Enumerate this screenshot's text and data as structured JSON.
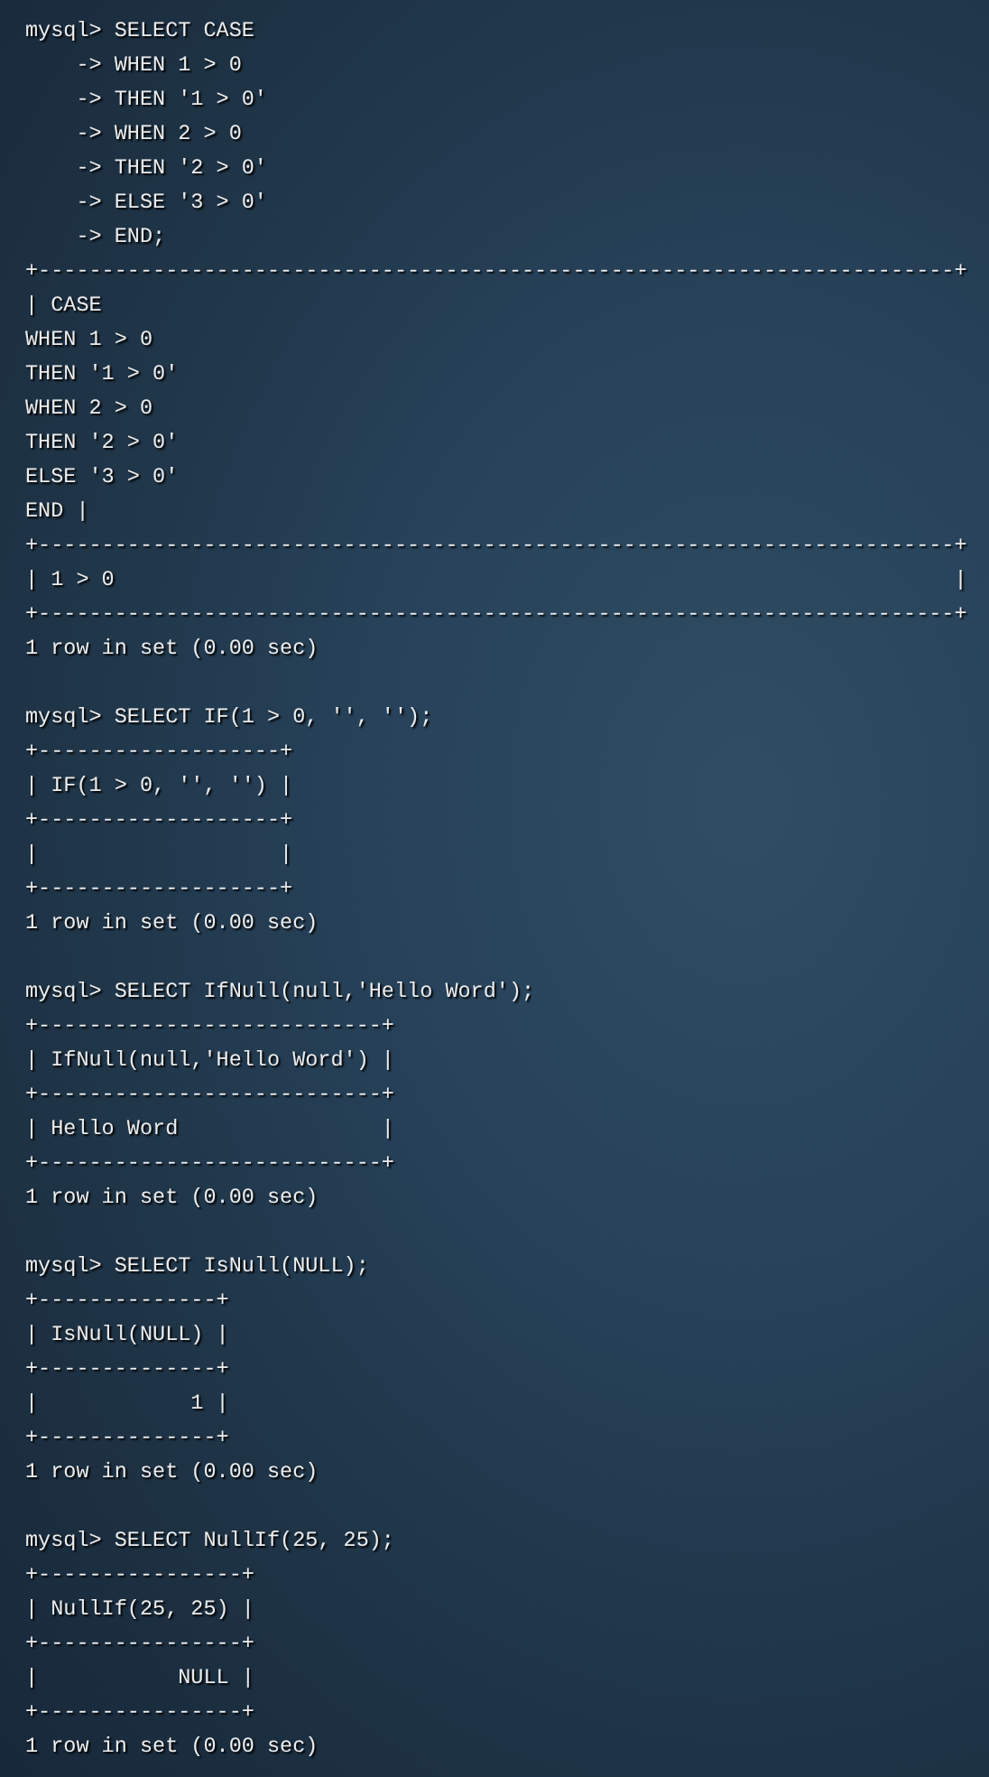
{
  "terminal": {
    "blocks": [
      {
        "command": [
          "mysql> SELECT CASE",
          "    -> WHEN 1 > 0",
          "    -> THEN '1 > 0'",
          "    -> WHEN 2 > 0",
          "    -> THEN '2 > 0'",
          "    -> ELSE '3 > 0'",
          "    -> END;"
        ],
        "table": [
          "+------------------------------------------------------------------------+",
          "| CASE",
          "WHEN 1 > 0",
          "THEN '1 > 0'",
          "WHEN 2 > 0",
          "THEN '2 > 0'",
          "ELSE '3 > 0'",
          "END |",
          "+------------------------------------------------------------------------+",
          "| 1 > 0                                                                  |",
          "+------------------------------------------------------------------------+"
        ],
        "summary": "1 row in set (0.00 sec)"
      },
      {
        "command": [
          "mysql> SELECT IF(1 > 0, '', '');"
        ],
        "table": [
          "+-------------------+",
          "| IF(1 > 0, '', '') |",
          "+-------------------+",
          "|                   |",
          "+-------------------+"
        ],
        "summary": "1 row in set (0.00 sec)"
      },
      {
        "command": [
          "mysql> SELECT IfNull(null,'Hello Word');"
        ],
        "table": [
          "+---------------------------+",
          "| IfNull(null,'Hello Word') |",
          "+---------------------------+",
          "| Hello Word                |",
          "+---------------------------+"
        ],
        "summary": "1 row in set (0.00 sec)"
      },
      {
        "command": [
          "mysql> SELECT IsNull(NULL);"
        ],
        "table": [
          "+--------------+",
          "| IsNull(NULL) |",
          "+--------------+",
          "|            1 |",
          "+--------------+"
        ],
        "summary": "1 row in set (0.00 sec)"
      },
      {
        "command": [
          "mysql> SELECT NullIf(25, 25);"
        ],
        "table": [
          "+----------------+",
          "| NullIf(25, 25) |",
          "+----------------+",
          "|           NULL |",
          "+----------------+"
        ],
        "summary": "1 row in set (0.00 sec)"
      }
    ]
  }
}
